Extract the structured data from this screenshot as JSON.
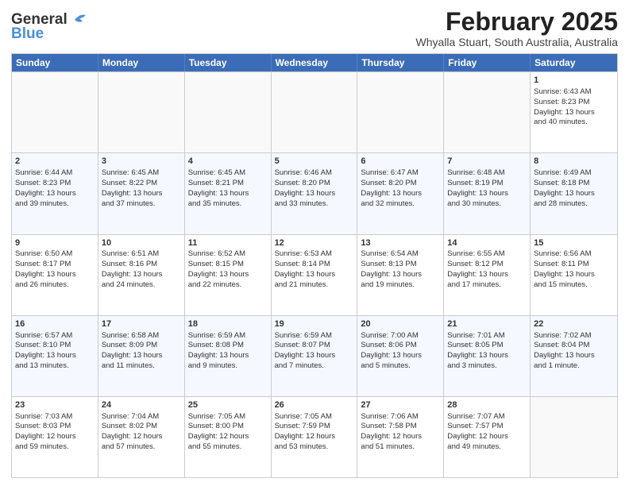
{
  "logo": {
    "general": "General",
    "blue": "Blue"
  },
  "title": "February 2025",
  "location": "Whyalla Stuart, South Australia, Australia",
  "weekdays": [
    "Sunday",
    "Monday",
    "Tuesday",
    "Wednesday",
    "Thursday",
    "Friday",
    "Saturday"
  ],
  "rows": [
    [
      {
        "day": "",
        "text": ""
      },
      {
        "day": "",
        "text": ""
      },
      {
        "day": "",
        "text": ""
      },
      {
        "day": "",
        "text": ""
      },
      {
        "day": "",
        "text": ""
      },
      {
        "day": "",
        "text": ""
      },
      {
        "day": "1",
        "text": "Sunrise: 6:43 AM\nSunset: 8:23 PM\nDaylight: 13 hours\nand 40 minutes."
      }
    ],
    [
      {
        "day": "2",
        "text": "Sunrise: 6:44 AM\nSunset: 8:23 PM\nDaylight: 13 hours\nand 39 minutes."
      },
      {
        "day": "3",
        "text": "Sunrise: 6:45 AM\nSunset: 8:22 PM\nDaylight: 13 hours\nand 37 minutes."
      },
      {
        "day": "4",
        "text": "Sunrise: 6:45 AM\nSunset: 8:21 PM\nDaylight: 13 hours\nand 35 minutes."
      },
      {
        "day": "5",
        "text": "Sunrise: 6:46 AM\nSunset: 8:20 PM\nDaylight: 13 hours\nand 33 minutes."
      },
      {
        "day": "6",
        "text": "Sunrise: 6:47 AM\nSunset: 8:20 PM\nDaylight: 13 hours\nand 32 minutes."
      },
      {
        "day": "7",
        "text": "Sunrise: 6:48 AM\nSunset: 8:19 PM\nDaylight: 13 hours\nand 30 minutes."
      },
      {
        "day": "8",
        "text": "Sunrise: 6:49 AM\nSunset: 8:18 PM\nDaylight: 13 hours\nand 28 minutes."
      }
    ],
    [
      {
        "day": "9",
        "text": "Sunrise: 6:50 AM\nSunset: 8:17 PM\nDaylight: 13 hours\nand 26 minutes."
      },
      {
        "day": "10",
        "text": "Sunrise: 6:51 AM\nSunset: 8:16 PM\nDaylight: 13 hours\nand 24 minutes."
      },
      {
        "day": "11",
        "text": "Sunrise: 6:52 AM\nSunset: 8:15 PM\nDaylight: 13 hours\nand 22 minutes."
      },
      {
        "day": "12",
        "text": "Sunrise: 6:53 AM\nSunset: 8:14 PM\nDaylight: 13 hours\nand 21 minutes."
      },
      {
        "day": "13",
        "text": "Sunrise: 6:54 AM\nSunset: 8:13 PM\nDaylight: 13 hours\nand 19 minutes."
      },
      {
        "day": "14",
        "text": "Sunrise: 6:55 AM\nSunset: 8:12 PM\nDaylight: 13 hours\nand 17 minutes."
      },
      {
        "day": "15",
        "text": "Sunrise: 6:56 AM\nSunset: 8:11 PM\nDaylight: 13 hours\nand 15 minutes."
      }
    ],
    [
      {
        "day": "16",
        "text": "Sunrise: 6:57 AM\nSunset: 8:10 PM\nDaylight: 13 hours\nand 13 minutes."
      },
      {
        "day": "17",
        "text": "Sunrise: 6:58 AM\nSunset: 8:09 PM\nDaylight: 13 hours\nand 11 minutes."
      },
      {
        "day": "18",
        "text": "Sunrise: 6:59 AM\nSunset: 8:08 PM\nDaylight: 13 hours\nand 9 minutes."
      },
      {
        "day": "19",
        "text": "Sunrise: 6:59 AM\nSunset: 8:07 PM\nDaylight: 13 hours\nand 7 minutes."
      },
      {
        "day": "20",
        "text": "Sunrise: 7:00 AM\nSunset: 8:06 PM\nDaylight: 13 hours\nand 5 minutes."
      },
      {
        "day": "21",
        "text": "Sunrise: 7:01 AM\nSunset: 8:05 PM\nDaylight: 13 hours\nand 3 minutes."
      },
      {
        "day": "22",
        "text": "Sunrise: 7:02 AM\nSunset: 8:04 PM\nDaylight: 13 hours\nand 1 minute."
      }
    ],
    [
      {
        "day": "23",
        "text": "Sunrise: 7:03 AM\nSunset: 8:03 PM\nDaylight: 12 hours\nand 59 minutes."
      },
      {
        "day": "24",
        "text": "Sunrise: 7:04 AM\nSunset: 8:02 PM\nDaylight: 12 hours\nand 57 minutes."
      },
      {
        "day": "25",
        "text": "Sunrise: 7:05 AM\nSunset: 8:00 PM\nDaylight: 12 hours\nand 55 minutes."
      },
      {
        "day": "26",
        "text": "Sunrise: 7:05 AM\nSunset: 7:59 PM\nDaylight: 12 hours\nand 53 minutes."
      },
      {
        "day": "27",
        "text": "Sunrise: 7:06 AM\nSunset: 7:58 PM\nDaylight: 12 hours\nand 51 minutes."
      },
      {
        "day": "28",
        "text": "Sunrise: 7:07 AM\nSunset: 7:57 PM\nDaylight: 12 hours\nand 49 minutes."
      },
      {
        "day": "",
        "text": ""
      }
    ]
  ]
}
